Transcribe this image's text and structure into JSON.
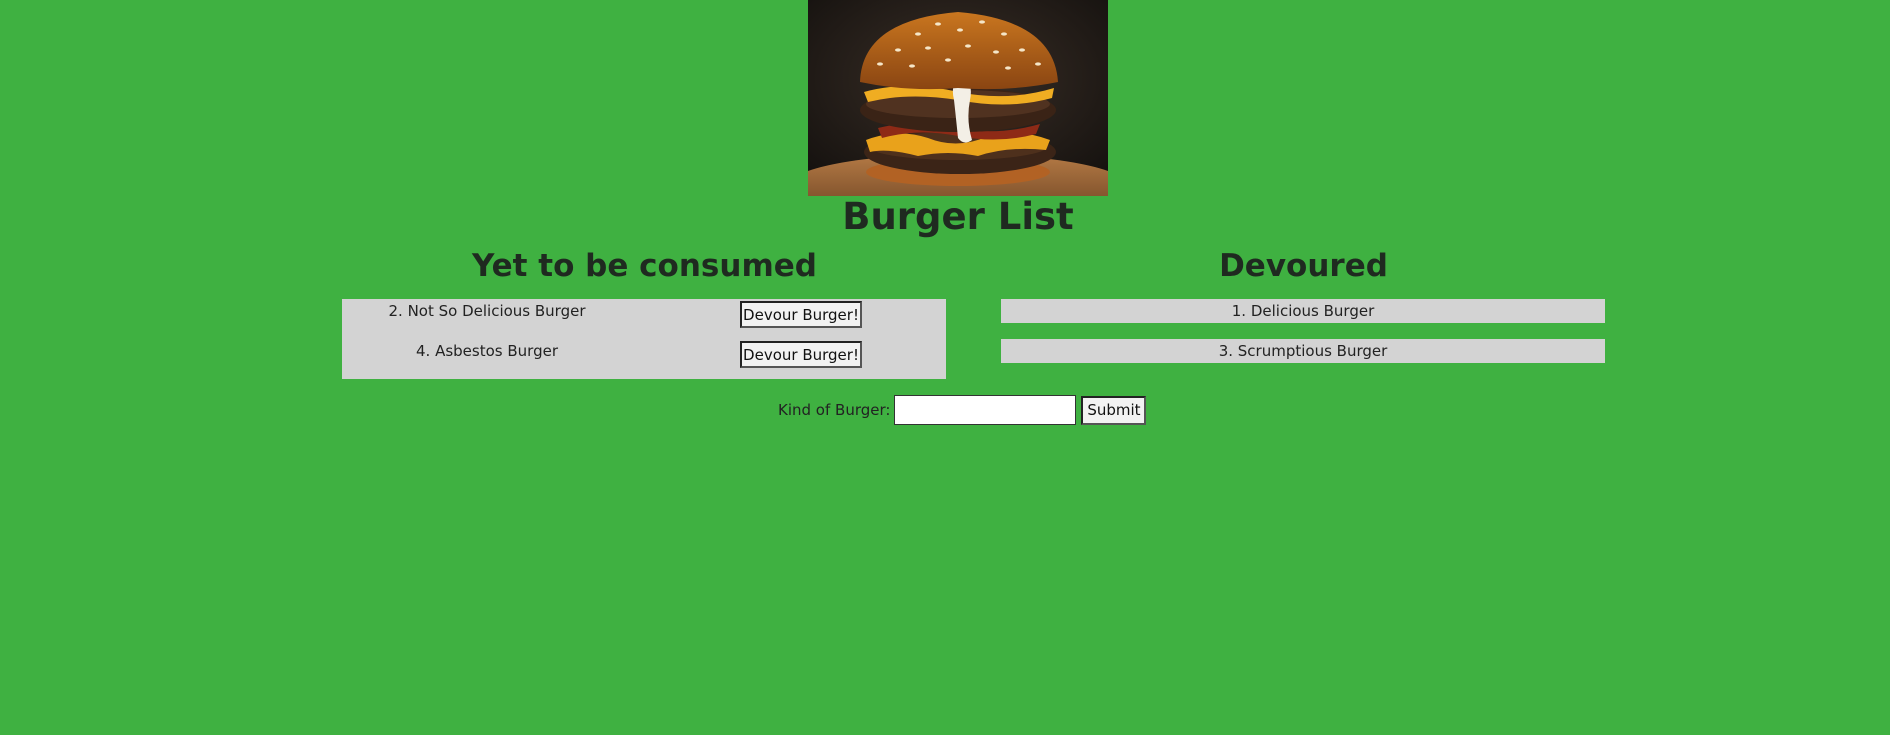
{
  "header": {
    "image_alt": "burger-photo",
    "title": "Burger List"
  },
  "columns": {
    "pending_title": "Yet to be consumed",
    "devoured_title": "Devoured"
  },
  "pending": [
    {
      "label": "2. Not So Delicious Burger",
      "button": "Devour Burger!"
    },
    {
      "label": "4. Asbestos Burger",
      "button": "Devour Burger!"
    }
  ],
  "devoured": [
    {
      "label": "1. Delicious Burger"
    },
    {
      "label": "3. Scrumptious Burger"
    }
  ],
  "form": {
    "label": "Kind of Burger:",
    "input_value": "",
    "input_placeholder": "",
    "submit_label": "Submit"
  },
  "colors": {
    "background": "#3fb141",
    "panel": "#d3d3d3",
    "text": "#1f2a20"
  }
}
